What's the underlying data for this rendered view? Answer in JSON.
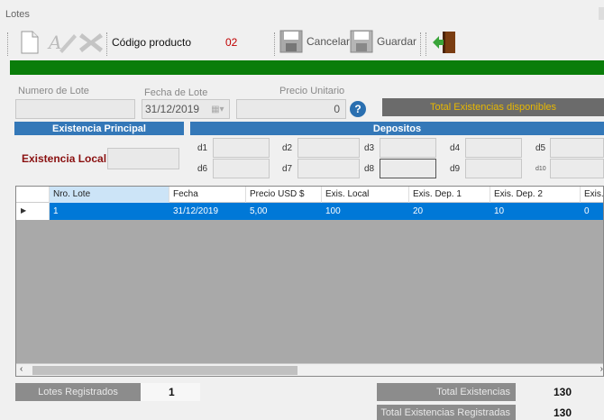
{
  "window": {
    "title": "Lotes"
  },
  "toolbar": {
    "codigo_label": "Código producto",
    "codigo_value": "02",
    "cancel_label": "Cancelar",
    "save_label": "Guardar"
  },
  "form": {
    "numero_lote_label": "Numero de Lote",
    "numero_lote_value": "",
    "fecha_lote_label": "Fecha de Lote",
    "fecha_lote_value": "31/12/2019",
    "precio_label": "Precio Unitario",
    "precio_value": "0",
    "total_existencias_label": "Total Existencias disponibles"
  },
  "sections": {
    "principal": "Existencia Principal",
    "depositos": "Depositos",
    "existencia_local_label": "Existencia Local"
  },
  "depositos": [
    {
      "label": "d1"
    },
    {
      "label": "d2"
    },
    {
      "label": "d3"
    },
    {
      "label": "d4"
    },
    {
      "label": "d5"
    },
    {
      "label": "d6"
    },
    {
      "label": "d7"
    },
    {
      "label": "d8"
    },
    {
      "label": "d9"
    },
    {
      "label": "d10"
    }
  ],
  "grid": {
    "columns": [
      "Nro. Lote",
      "Fecha",
      "Precio USD $",
      "Exis. Local",
      "Exis. Dep. 1",
      "Exis. Dep. 2",
      "Exis."
    ],
    "rows": [
      [
        "1",
        "31/12/2019",
        "5,00",
        "100",
        "20",
        "10",
        "0"
      ]
    ]
  },
  "footer": {
    "lotes_label": "Lotes Registrados",
    "lotes_value": "1",
    "total_label": "Total Existencias",
    "total_value": "130",
    "total_reg_label": "Total Existencias Registradas",
    "total_reg_value": "130"
  },
  "colors": {
    "accent_green": "#0a7d0a",
    "section_blue": "#3478b8",
    "selected_row": "#0078d7",
    "code_red": "#c00000"
  }
}
